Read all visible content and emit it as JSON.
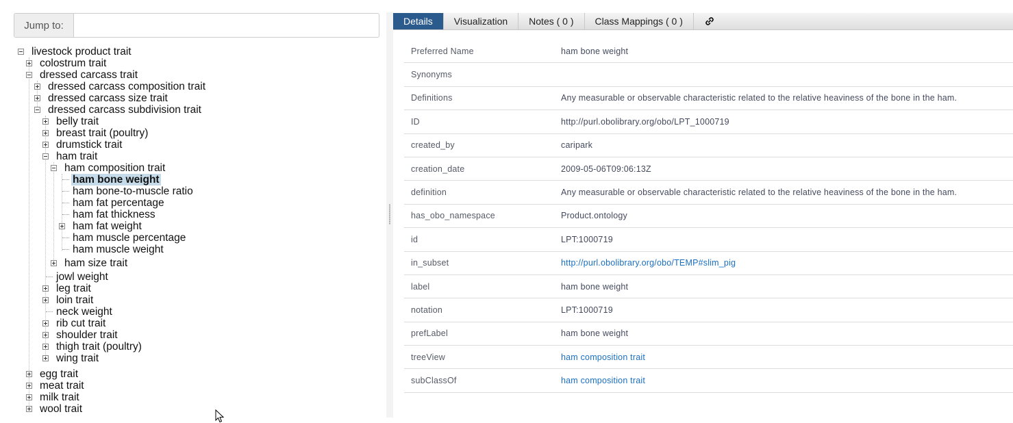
{
  "jump": {
    "label": "Jump to:",
    "placeholder": ""
  },
  "tree": {
    "root": "livestock product trait",
    "colostrum": "colostrum trait",
    "dressed": "dressed carcass trait",
    "dc_composition": "dressed carcass composition trait",
    "dc_size": "dressed carcass size trait",
    "dc_subdivision": "dressed carcass subdivision trait",
    "belly": "belly trait",
    "breast": "breast trait (poultry)",
    "drumstick": "drumstick trait",
    "ham": "ham trait",
    "ham_composition": "ham composition trait",
    "ham_bone_weight": "ham bone weight",
    "ham_bone_muscle": "ham bone-to-muscle ratio",
    "ham_fat_pct": "ham fat percentage",
    "ham_fat_thick": "ham fat thickness",
    "ham_fat_weight": "ham fat weight",
    "ham_muscle_pct": "ham muscle percentage",
    "ham_muscle_weight": "ham muscle weight",
    "ham_size": "ham size trait",
    "jowl": "jowl weight",
    "leg": "leg trait",
    "loin": "loin trait",
    "neck": "neck weight",
    "rib": "rib cut trait",
    "shoulder": "shoulder trait",
    "thigh": "thigh trait (poultry)",
    "wing": "wing trait",
    "egg": "egg trait",
    "meat": "meat trait",
    "milk": "milk trait",
    "wool": "wool trait"
  },
  "tabs": {
    "details": "Details",
    "visualization": "Visualization",
    "notes": "Notes ( 0 )",
    "mappings": "Class Mappings ( 0 )",
    "link_icon": "link-icon"
  },
  "details": [
    {
      "key": "Preferred Name",
      "value": "ham bone weight"
    },
    {
      "key": "Synonyms",
      "value": ""
    },
    {
      "key": "Definitions",
      "value": "Any measurable or observable characteristic related to the relative heaviness of the bone in the ham."
    },
    {
      "key": "ID",
      "value": "http://purl.obolibrary.org/obo/LPT_1000719"
    },
    {
      "key": "created_by",
      "value": "caripark"
    },
    {
      "key": "creation_date",
      "value": "2009-05-06T09:06:13Z"
    },
    {
      "key": "definition",
      "value": "Any measurable or observable characteristic related to the relative heaviness of the bone in the ham."
    },
    {
      "key": "has_obo_namespace",
      "value": "Product.ontology"
    },
    {
      "key": "id",
      "value": "LPT:1000719"
    },
    {
      "key": "in_subset",
      "value": "http://purl.obolibrary.org/obo/TEMP#slim_pig"
    },
    {
      "key": "label",
      "value": "ham bone weight"
    },
    {
      "key": "notation",
      "value": "LPT:1000719"
    },
    {
      "key": "prefLabel",
      "value": "ham bone weight"
    },
    {
      "key": "treeView",
      "value": "ham composition trait"
    },
    {
      "key": "subClassOf",
      "value": "ham composition trait"
    }
  ],
  "colors": {
    "active_tab": "#2b5a8c",
    "link": "#1a6fc0",
    "selected": "#c5dbe9"
  }
}
